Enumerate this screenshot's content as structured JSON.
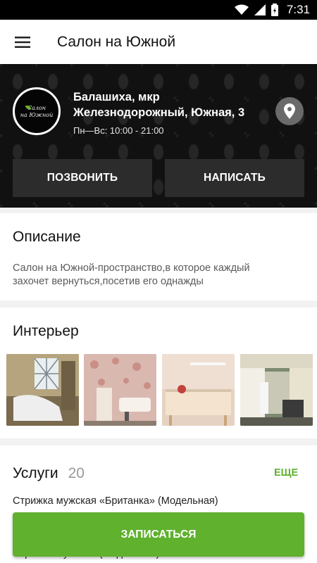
{
  "status": {
    "time": "7:31"
  },
  "appbar": {
    "title": "Салон на Южной"
  },
  "salon": {
    "logo_line1": "Салон",
    "logo_line2": "на Южной",
    "address_line1": "Балашиха, мкр",
    "address_line2": "Железнодорожный, Южная, 3",
    "hours": "Пн—Вс: 10:00 - 21:00"
  },
  "actions": {
    "call_label": "ПОЗВОНИТЬ",
    "write_label": "НАПИСАТЬ"
  },
  "description": {
    "title": "Описание",
    "line1": "Салон на Южной-пространство,в которое каждый",
    "line2": "захочет вернуться,посетив его однажды"
  },
  "interior": {
    "title": "Интерьер"
  },
  "services": {
    "title": "Услуги",
    "count": "20",
    "more_label": "ЕЩЕ",
    "first_item": "Стрижка мужская «Британка» (Модельная)",
    "second_item_partial": "Стрижка мужская (Модельная)"
  },
  "book": {
    "label": "ЗАПИСАТЬСЯ"
  },
  "colors": {
    "accent": "#5fb12e",
    "hero_bg": "#111111",
    "button_dark": "#2c2c2c"
  }
}
